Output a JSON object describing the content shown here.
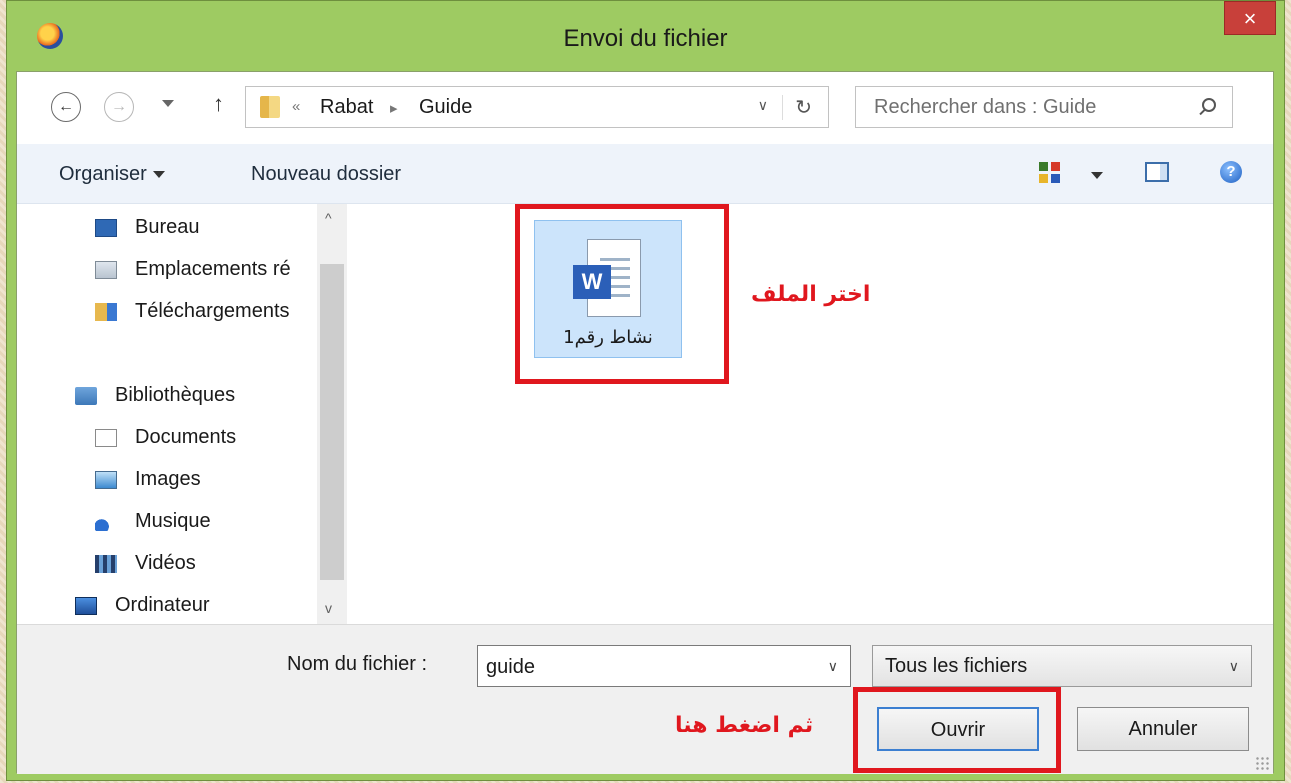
{
  "window": {
    "title": "Envoi du fichier",
    "close": "×"
  },
  "nav": {
    "back": "←",
    "forward": "→",
    "up": "↑"
  },
  "address": {
    "prefix": "«",
    "crumbs": [
      "Rabat",
      "Guide"
    ],
    "separator": "▸",
    "dropdown": "∨",
    "refresh": "↻"
  },
  "search": {
    "placeholder": "Rechercher dans : Guide"
  },
  "toolbar": {
    "organize": "Organiser",
    "new_folder": "Nouveau dossier",
    "help": "?"
  },
  "sidebar": {
    "items": [
      {
        "label": "Bureau",
        "icon": "desktop-icon"
      },
      {
        "label": "Emplacements ré",
        "icon": "network-locations-icon"
      },
      {
        "label": "Téléchargements",
        "icon": "downloads-folder-icon"
      },
      {
        "label": "Bibliothèques",
        "icon": "libraries-icon"
      },
      {
        "label": "Documents",
        "icon": "documents-icon"
      },
      {
        "label": "Images",
        "icon": "pictures-icon"
      },
      {
        "label": "Musique",
        "icon": "music-icon"
      },
      {
        "label": "Vidéos",
        "icon": "videos-icon"
      },
      {
        "label": "Ordinateur",
        "icon": "computer-icon"
      }
    ],
    "scroll_up": "^",
    "scroll_down": "v"
  },
  "files": [
    {
      "name": "نشاط رقم1",
      "type": "word-document",
      "badge": "W"
    }
  ],
  "annotations": {
    "choose_file": "اختر الملف",
    "then_click": "ثم اضغط هنا",
    "color": "#e0171e"
  },
  "footer": {
    "filename_label": "Nom du fichier :",
    "filename_value": "guide",
    "filetype_value": "Tous les fichiers",
    "dropdown": "∨",
    "open_button": "Ouvrir",
    "cancel_button": "Annuler"
  },
  "colors": {
    "titlebar": "#9ecb62",
    "close": "#c8403a",
    "selection": "#cce4fb",
    "toolbar": "#eef3fa"
  }
}
